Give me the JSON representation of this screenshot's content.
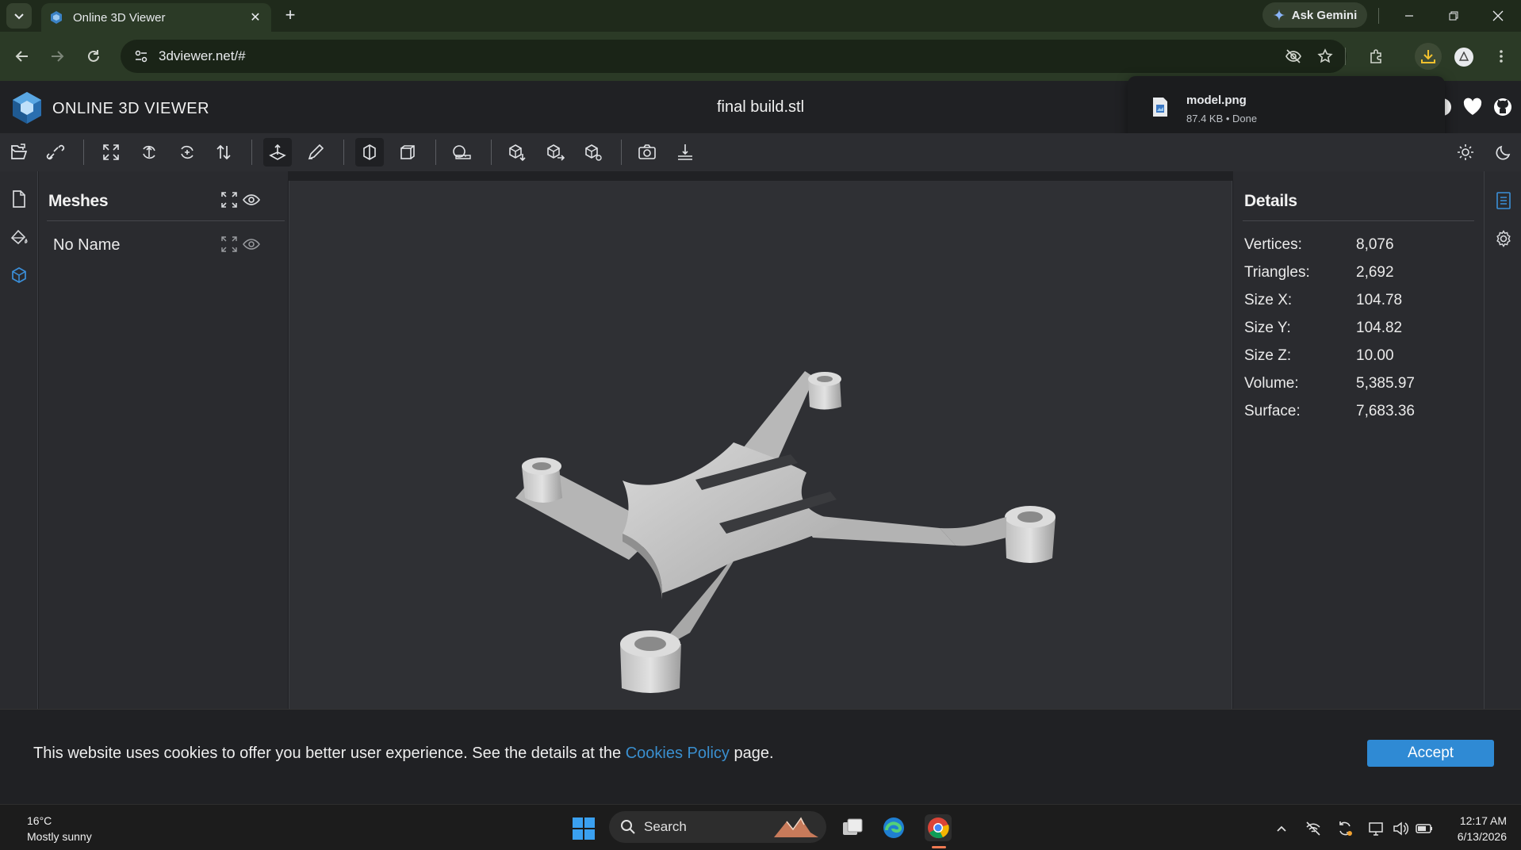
{
  "browser": {
    "tab_title": "Online 3D Viewer",
    "new_tab": "+",
    "ask_gemini": "Ask Gemini",
    "url": "3dviewer.net/#"
  },
  "download": {
    "filename": "model.png",
    "meta": "87.4 KB • Done"
  },
  "app": {
    "brand": "ONLINE 3D VIEWER",
    "file_title": "final build.stl",
    "accent": "#2f8ad4"
  },
  "meshes": {
    "title": "Meshes",
    "items": [
      {
        "name": "No Name"
      }
    ]
  },
  "details": {
    "title": "Details",
    "rows": [
      {
        "key": "Vertices:",
        "value": "8,076"
      },
      {
        "key": "Triangles:",
        "value": "2,692"
      },
      {
        "key": "Size X:",
        "value": "104.78"
      },
      {
        "key": "Size Y:",
        "value": "104.82"
      },
      {
        "key": "Size Z:",
        "value": "10.00"
      },
      {
        "key": "Volume:",
        "value": "5,385.97"
      },
      {
        "key": "Surface:",
        "value": "7,683.36"
      }
    ]
  },
  "cookie": {
    "text_before": "This website uses cookies to offer you better user experience. See the details at the ",
    "link": "Cookies Policy",
    "text_after": " page.",
    "accept": "Accept"
  },
  "taskbar": {
    "temp": "16°C",
    "weather": "Mostly sunny",
    "search": "Search",
    "time": "12:17 AM",
    "date": "6/13/2026"
  }
}
